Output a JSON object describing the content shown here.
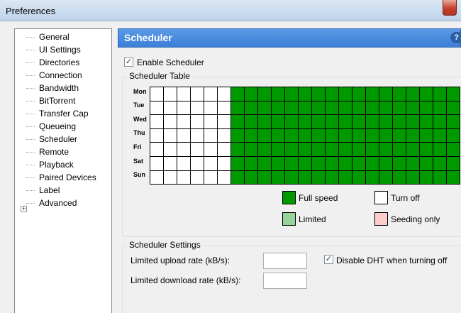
{
  "window": {
    "title": "Preferences"
  },
  "colors": {
    "full_speed": "#009900",
    "limited": "#99d399",
    "turn_off": "#ffffff",
    "seeding_only": "#ffcccc",
    "header": "#3d7ed8"
  },
  "sidebar": {
    "items": [
      {
        "label": "General"
      },
      {
        "label": "UI Settings"
      },
      {
        "label": "Directories"
      },
      {
        "label": "Connection"
      },
      {
        "label": "Bandwidth"
      },
      {
        "label": "BitTorrent"
      },
      {
        "label": "Transfer Cap"
      },
      {
        "label": "Queueing"
      },
      {
        "label": "Scheduler",
        "selected": true
      },
      {
        "label": "Remote"
      },
      {
        "label": "Playback"
      },
      {
        "label": "Paired Devices"
      },
      {
        "label": "Label"
      },
      {
        "label": "Advanced",
        "expandable": true
      }
    ]
  },
  "panel": {
    "title": "Scheduler",
    "help_icon": "?",
    "enable_scheduler": {
      "label": "Enable Scheduler",
      "checked": true
    },
    "table_group": "Scheduler Table",
    "days": [
      "Mon",
      "Tue",
      "Wed",
      "Thu",
      "Fri",
      "Sat",
      "Sun"
    ],
    "grid": {
      "white_cells_per_row": 6,
      "green_cells_visible": 17
    },
    "legend": {
      "full_speed": "Full speed",
      "turn_off": "Turn off",
      "limited": "Limited",
      "seeding_only": "Seeding only"
    },
    "settings_group": "Scheduler Settings",
    "upload_label": "Limited upload rate (kB/s):",
    "download_label": "Limited download rate (kB/s):",
    "upload_value": "",
    "download_value": "",
    "disable_dht": {
      "label": "Disable DHT when turning off",
      "checked": true
    }
  }
}
